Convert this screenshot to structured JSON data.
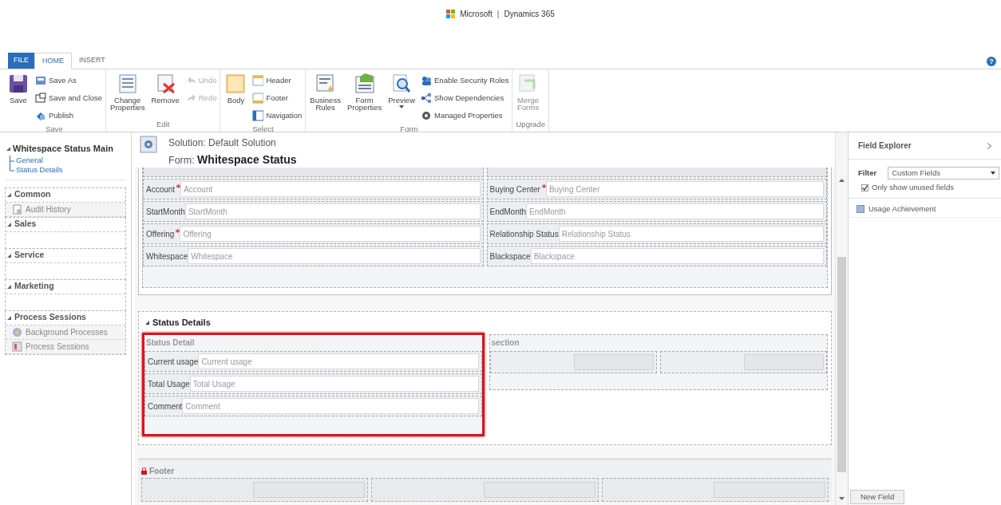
{
  "brand": {
    "company": "Microsoft",
    "product": "Dynamics 365",
    "separator": "|"
  },
  "tabs": [
    {
      "label": "FILE",
      "kind": "file",
      "selected": false
    },
    {
      "label": "HOME",
      "kind": "tab",
      "selected": true
    },
    {
      "label": "INSERT",
      "kind": "tab",
      "selected": false
    }
  ],
  "help": "?",
  "ribbon": {
    "groups": [
      {
        "label": "Save",
        "buttons": [
          {
            "label": "Save",
            "kind": "large",
            "disabled": false
          },
          {
            "label": "Save As",
            "kind": "small",
            "disabled": false
          },
          {
            "label": "Save and Close",
            "kind": "small",
            "disabled": false
          },
          {
            "label": "Publish",
            "kind": "small",
            "disabled": false
          }
        ]
      },
      {
        "label": "Edit",
        "buttons": [
          {
            "label": "Change Properties",
            "kind": "large",
            "disabled": false
          },
          {
            "label": "Remove",
            "kind": "large",
            "disabled": false
          },
          {
            "label": "Undo",
            "kind": "small",
            "disabled": true
          },
          {
            "label": "Redo",
            "kind": "small",
            "disabled": true
          }
        ]
      },
      {
        "label": "Select",
        "buttons": [
          {
            "label": "Body",
            "kind": "large",
            "disabled": false
          },
          {
            "label": "Header",
            "kind": "small",
            "disabled": false
          },
          {
            "label": "Footer",
            "kind": "small",
            "disabled": false
          },
          {
            "label": "Navigation",
            "kind": "small",
            "disabled": false
          }
        ]
      },
      {
        "label": "Form",
        "buttons": [
          {
            "label": "Business Rules",
            "kind": "large",
            "disabled": false
          },
          {
            "label": "Form Properties",
            "kind": "large",
            "disabled": false
          },
          {
            "label": "Preview",
            "kind": "large",
            "dropdown": true,
            "disabled": false
          },
          {
            "label": "Enable Security Roles",
            "kind": "small",
            "disabled": false
          },
          {
            "label": "Show Dependencies",
            "kind": "small",
            "disabled": false
          },
          {
            "label": "Managed Properties",
            "kind": "small",
            "disabled": false
          }
        ]
      },
      {
        "label": "Upgrade",
        "buttons": [
          {
            "label": "Merge Forms",
            "kind": "large",
            "disabled": true
          }
        ]
      }
    ]
  },
  "navigation": [
    {
      "label": "Whitespace Status Main",
      "children": [
        {
          "label": "General"
        },
        {
          "label": "Status Details"
        }
      ]
    },
    {
      "label": "Common",
      "children": [
        {
          "label": "Audit History"
        }
      ]
    },
    {
      "label": "Sales"
    },
    {
      "label": "Service"
    },
    {
      "label": "Marketing"
    },
    {
      "label": "Process Sessions",
      "children": [
        {
          "label": "Background Processes"
        },
        {
          "label": "Process Sessions"
        }
      ]
    }
  ],
  "form_header": {
    "solution": "Solution: Default Solution",
    "form": "Form: **Whitespace Status**"
  },
  "general_section": {
    "columns": [
      [
        {
          "label": "Account",
          "required": true,
          "placeholder": "Account"
        },
        {
          "label": "StartMonth",
          "required": false,
          "placeholder": "StartMonth"
        },
        {
          "label": "Offering",
          "required": true,
          "placeholder": "Offering"
        },
        {
          "label": "Whitespace",
          "required": false,
          "placeholder": "Whitespace"
        }
      ],
      [
        {
          "label": "Buying Center",
          "required": true,
          "placeholder": "Buying Center"
        },
        {
          "label": "EndMonth",
          "required": false,
          "placeholder": "EndMonth"
        },
        {
          "label": "Relationship Status",
          "required": false,
          "placeholder": "Relationship Status"
        },
        {
          "label": "Blackspace",
          "required": false,
          "placeholder": "Blackspace"
        }
      ]
    ]
  },
  "status_tab": {
    "title": "Status Details",
    "sections": [
      {
        "title": "Status Detail",
        "highlighted": true,
        "fields": [
          {
            "label": "Current usage",
            "placeholder": "Current usage"
          },
          {
            "label": "Total Usage",
            "placeholder": "Total Usage"
          },
          {
            "label": "Comment",
            "placeholder": "Comment"
          }
        ]
      },
      {
        "title": "section",
        "highlighted": false
      }
    ]
  },
  "footer": {
    "title": "Footer"
  },
  "field_explorer": {
    "title": "Field Explorer",
    "filter_label": "Filter",
    "filter_value": "Custom Fields",
    "unused_only": {
      "label": "Only show unused fields",
      "checked": true
    },
    "fields": [
      {
        "label": "Usage Achievement"
      }
    ],
    "new_button": "New Field"
  }
}
